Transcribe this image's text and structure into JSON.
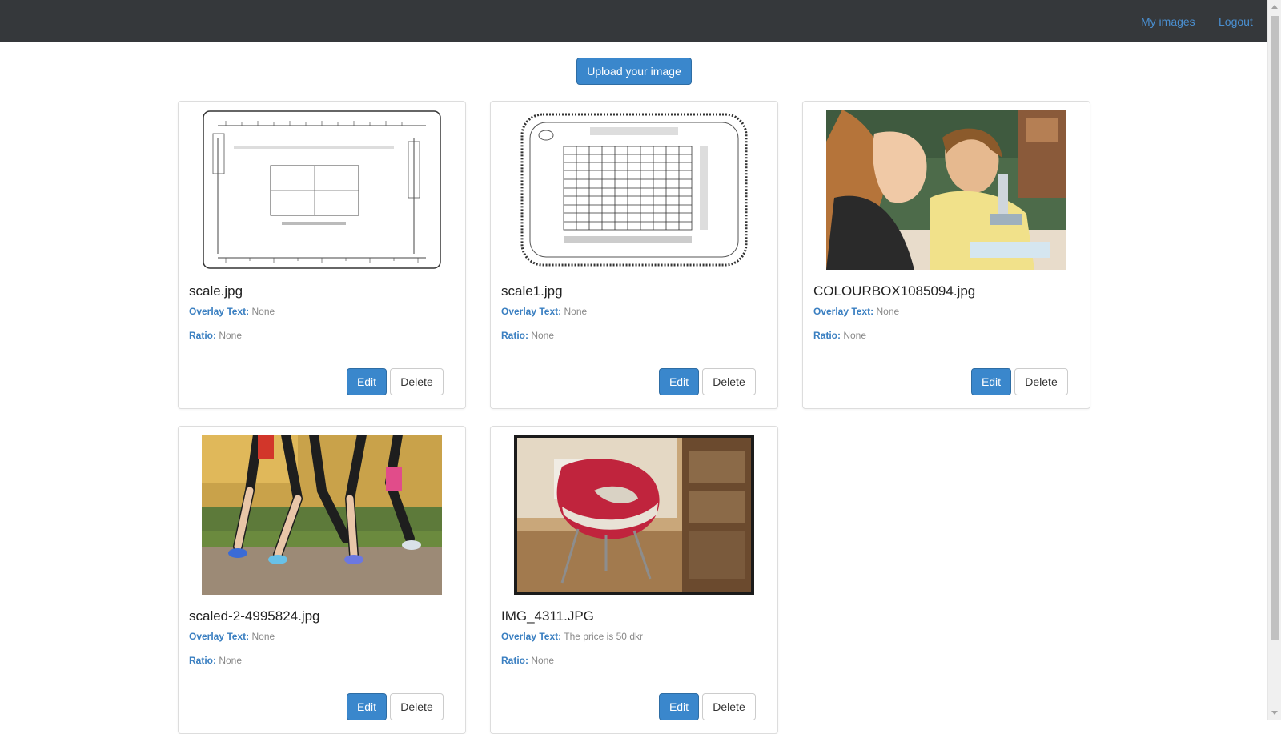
{
  "nav": {
    "my_images": "My images",
    "logout": "Logout",
    "bg_color": "#35383b",
    "link_color": "#4a8fd0"
  },
  "upload_button": "Upload your image",
  "labels": {
    "overlay": "Overlay Text:",
    "ratio": "Ratio:",
    "edit": "Edit",
    "delete": "Delete"
  },
  "cards": [
    {
      "title": "scale.jpg",
      "overlay": "None",
      "ratio": "None",
      "thumb": "ruler-scale-image"
    },
    {
      "title": "scale1.jpg",
      "overlay": "None",
      "ratio": "None",
      "thumb": "utm-grid-image"
    },
    {
      "title": "COLOURBOX1085094.jpg",
      "overlay": "None",
      "ratio": "None",
      "thumb": "students-microscope-photo"
    },
    {
      "title": "scaled-2-4995824.jpg",
      "overlay": "None",
      "ratio": "None",
      "thumb": "runners-legs-photo"
    },
    {
      "title": "IMG_4311.JPG",
      "overlay": "The price is 50 dkr",
      "ratio": "None",
      "thumb": "red-chair-photo"
    }
  ],
  "colors": {
    "primary": "#3a87cc",
    "label_blue": "#3a7fc1",
    "muted": "#888888"
  }
}
